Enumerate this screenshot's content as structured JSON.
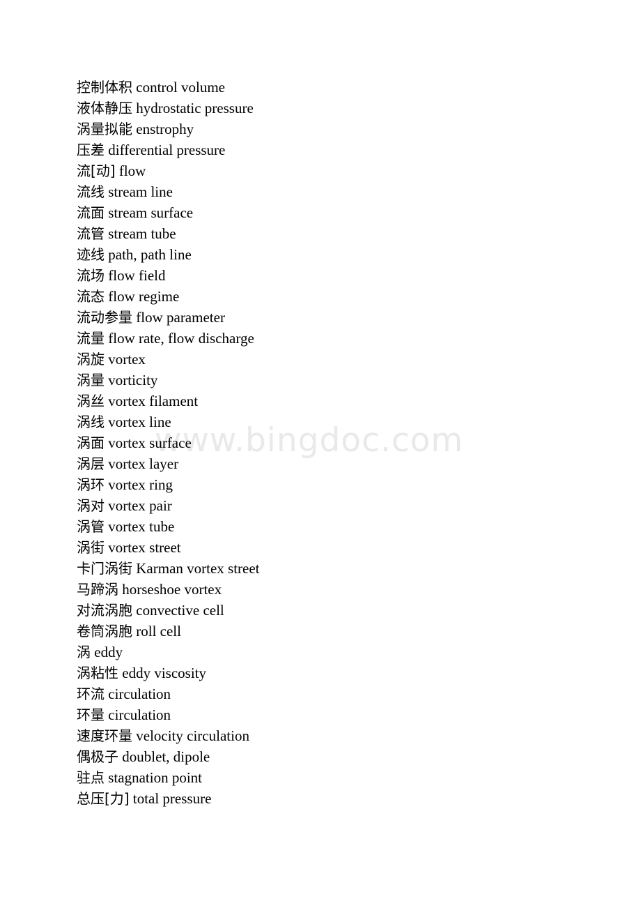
{
  "document": {
    "background_color": "#ffffff",
    "text_color": "#000000",
    "watermark": {
      "text": "www.bingdoc.com",
      "color": "#e9e9e9"
    }
  },
  "glossary": {
    "entries": [
      {
        "term": "控制体积",
        "gloss": "control volume"
      },
      {
        "term": "液体静压",
        "gloss": "hydrostatic pressure"
      },
      {
        "term": "涡量拟能",
        "gloss": "enstrophy"
      },
      {
        "term": "压差",
        "gloss": "differential pressure"
      },
      {
        "term": "流[动]",
        "gloss": "flow"
      },
      {
        "term": "流线",
        "gloss": "stream line"
      },
      {
        "term": "流面",
        "gloss": "stream surface"
      },
      {
        "term": "流管",
        "gloss": "stream tube"
      },
      {
        "term": "迹线",
        "gloss": "path, path line"
      },
      {
        "term": "流场",
        "gloss": "flow field"
      },
      {
        "term": "流态",
        "gloss": "flow regime"
      },
      {
        "term": "流动参量",
        "gloss": "flow parameter"
      },
      {
        "term": "流量",
        "gloss": "flow rate, flow discharge"
      },
      {
        "term": "涡旋",
        "gloss": "vortex"
      },
      {
        "term": "涡量",
        "gloss": "vorticity"
      },
      {
        "term": "涡丝",
        "gloss": "vortex filament"
      },
      {
        "term": "涡线",
        "gloss": "vortex line"
      },
      {
        "term": "涡面",
        "gloss": "vortex surface"
      },
      {
        "term": "涡层",
        "gloss": "vortex layer"
      },
      {
        "term": "涡环",
        "gloss": "vortex ring"
      },
      {
        "term": "涡对",
        "gloss": "vortex pair"
      },
      {
        "term": "涡管",
        "gloss": "vortex tube"
      },
      {
        "term": "涡街",
        "gloss": "vortex street"
      },
      {
        "term": "卡门涡街",
        "gloss": "Karman vortex street"
      },
      {
        "term": "马蹄涡",
        "gloss": "horseshoe vortex"
      },
      {
        "term": "对流涡胞",
        "gloss": "convective cell"
      },
      {
        "term": "卷筒涡胞",
        "gloss": "roll cell"
      },
      {
        "term": "涡",
        "gloss": "eddy"
      },
      {
        "term": "涡粘性",
        "gloss": "eddy viscosity"
      },
      {
        "term": "环流",
        "gloss": "circulation"
      },
      {
        "term": "环量",
        "gloss": "circulation"
      },
      {
        "term": "速度环量",
        "gloss": "velocity circulation"
      },
      {
        "term": "偶极子",
        "gloss": "doublet, dipole"
      },
      {
        "term": "驻点",
        "gloss": "stagnation point"
      },
      {
        "term": "总压[力]",
        "gloss": "total pressure"
      }
    ]
  }
}
